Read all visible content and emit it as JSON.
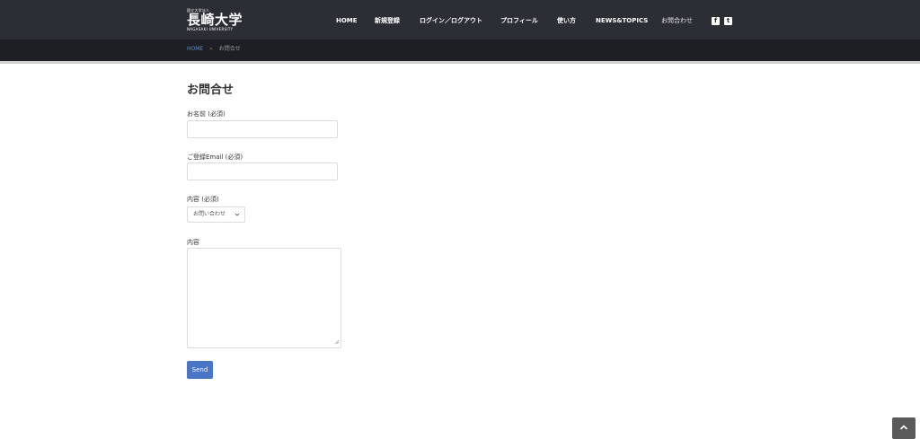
{
  "logo": {
    "small": "国立大学法人",
    "main": "長崎大学",
    "en": "NAGASAKI UNIVERSITY"
  },
  "nav": {
    "items": [
      {
        "label": "HOME"
      },
      {
        "label": "新規登録"
      },
      {
        "label": "ログイン／ログアウト"
      },
      {
        "label": "プロフィール"
      },
      {
        "label": "使い方"
      },
      {
        "label": "NEWS&TOPICS"
      },
      {
        "label": "お問合わせ"
      }
    ],
    "social": {
      "facebook": "f",
      "twitter": "t"
    }
  },
  "breadcrumb": {
    "home": "HOME",
    "separator": "»",
    "current": "お問合せ"
  },
  "page": {
    "title": "お問合せ"
  },
  "form": {
    "name_label": "お名前 (必須)",
    "name_value": "",
    "email_label": "ご登録Email (必須)",
    "email_value": "",
    "type_label": "内容 (必須)",
    "type_selected": "お問い合わせ",
    "content_label": "内容",
    "content_value": "",
    "submit_label": "Send"
  },
  "colors": {
    "header_bg": "#2b2e35",
    "breadcrumb_bg": "#1d1f24",
    "link": "#5b8ed6",
    "button": "#4a74c4"
  }
}
